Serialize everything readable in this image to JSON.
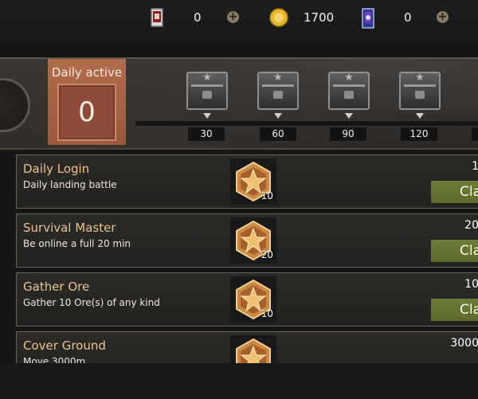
{
  "currencies": [
    {
      "name": "card-ticket",
      "value": "0"
    },
    {
      "name": "gold-coin",
      "value": "1700"
    },
    {
      "name": "blue-card",
      "value": "0"
    }
  ],
  "daily_active": {
    "label": "Daily active",
    "value": "0"
  },
  "milestones": [
    "30",
    "60",
    "90",
    "120"
  ],
  "tasks": [
    {
      "title": "Daily Login",
      "description": "Daily landing battle",
      "reward_count": "10",
      "points": "1",
      "button": "Cla"
    },
    {
      "title": "Survival Master",
      "description": "Be online a full 20 min",
      "reward_count": "20",
      "points": "20",
      "button": "Cla"
    },
    {
      "title": "Gather Ore",
      "description": "Gather 10 Ore(s) of any kind",
      "reward_count": "10",
      "points": "10",
      "button": "Cla"
    },
    {
      "title": "Cover Ground",
      "description": "Move 3000m",
      "reward_count": "",
      "points": "3000",
      "button": ""
    }
  ],
  "colors": {
    "accent": "#b06c4c",
    "claim": "#6d7c37",
    "task_title": "#e9c48c"
  }
}
